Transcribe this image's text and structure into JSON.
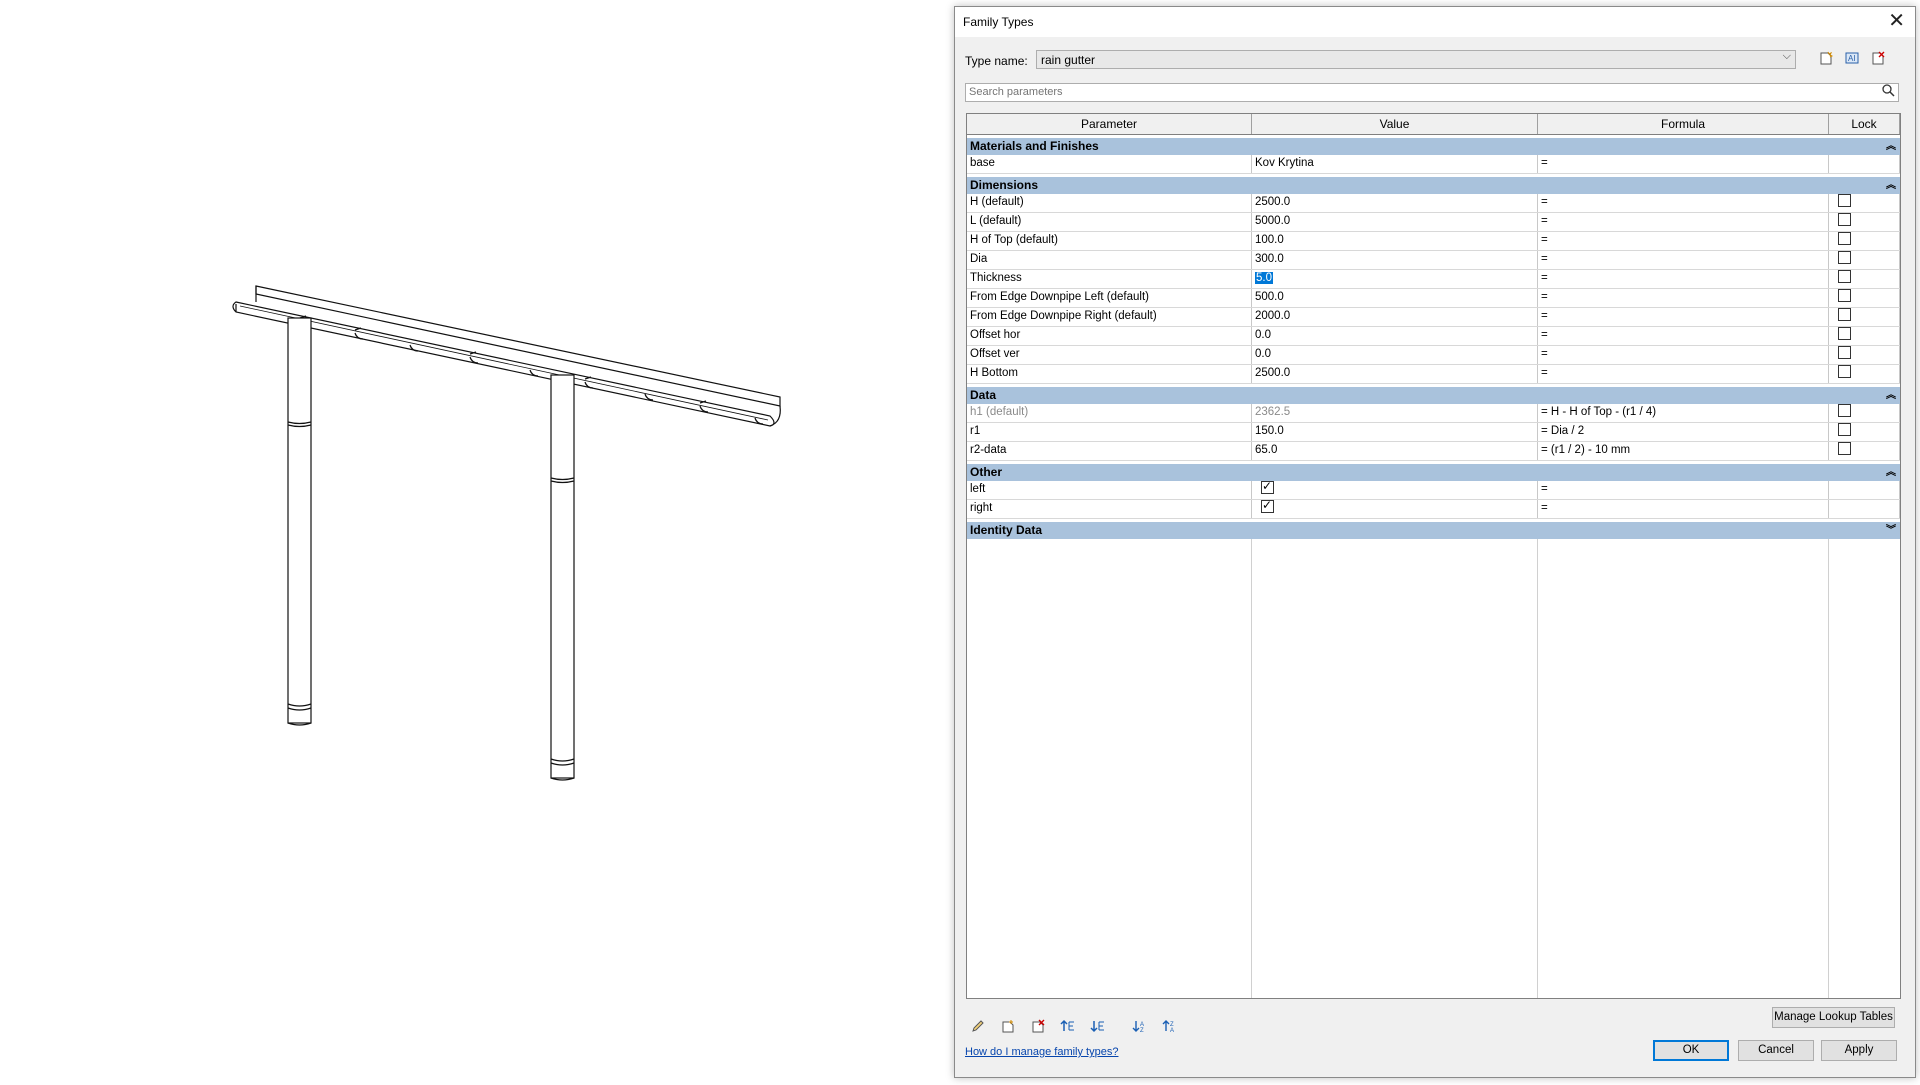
{
  "dialog": {
    "title": "Family Types",
    "type_name_label": "Type name:",
    "type_name_value": "rain gutter",
    "search_placeholder": "Search parameters"
  },
  "columns": [
    "Parameter",
    "Value",
    "Formula",
    "Lock"
  ],
  "groups": {
    "materials": "Materials and Finishes",
    "dimensions": "Dimensions",
    "data": "Data",
    "other": "Other",
    "identity": "Identity Data"
  },
  "materials_rows": [
    {
      "param": "base",
      "value": "Kov Krytina",
      "formula": "="
    }
  ],
  "dimension_rows": [
    {
      "param": "H (default)",
      "value": "2500.0",
      "formula": "="
    },
    {
      "param": "L (default)",
      "value": "5000.0",
      "formula": "="
    },
    {
      "param": "H of Top (default)",
      "value": "100.0",
      "formula": "="
    },
    {
      "param": "Dia",
      "value": "300.0",
      "formula": "="
    },
    {
      "param": "Thickness",
      "value": "5.0",
      "formula": "="
    },
    {
      "param": "From Edge Downpipe Left (default)",
      "value": "500.0",
      "formula": "="
    },
    {
      "param": "From Edge Downpipe Right (default)",
      "value": "2000.0",
      "formula": "="
    },
    {
      "param": "Offset hor",
      "value": "0.0",
      "formula": "="
    },
    {
      "param": "Offset ver",
      "value": "0.0",
      "formula": "="
    },
    {
      "param": "H Bottom",
      "value": "2500.0",
      "formula": "="
    }
  ],
  "data_rows": [
    {
      "param": "h1 (default)",
      "value": "2362.5",
      "formula": "= H - H of Top - (r1 / 4)"
    },
    {
      "param": "r1",
      "value": "150.0",
      "formula": "= Dia / 2"
    },
    {
      "param": "r2-data",
      "value": "65.0",
      "formula": "= (r1 / 2) - 10 mm"
    }
  ],
  "other_rows": [
    {
      "param": "left",
      "formula": "="
    },
    {
      "param": "right",
      "formula": "="
    }
  ],
  "footer": {
    "help_link": "How do I manage family types?",
    "manage_lookup": "Manage Lookup Tables",
    "ok": "OK",
    "cancel": "Cancel",
    "apply": "Apply"
  },
  "icons": [
    "pencil-icon",
    "new-parameter-icon",
    "delete-parameter-icon",
    "move-up-icon",
    "move-down-icon",
    "sort-ascending-icon",
    "sort-descending-icon",
    "new-type-icon",
    "rename-type-icon",
    "delete-type-icon",
    "search-icon",
    "close-icon"
  ],
  "colors": {
    "group_header": "#a9c2dc",
    "selection": "#0078d7",
    "link": "#0645ad"
  }
}
